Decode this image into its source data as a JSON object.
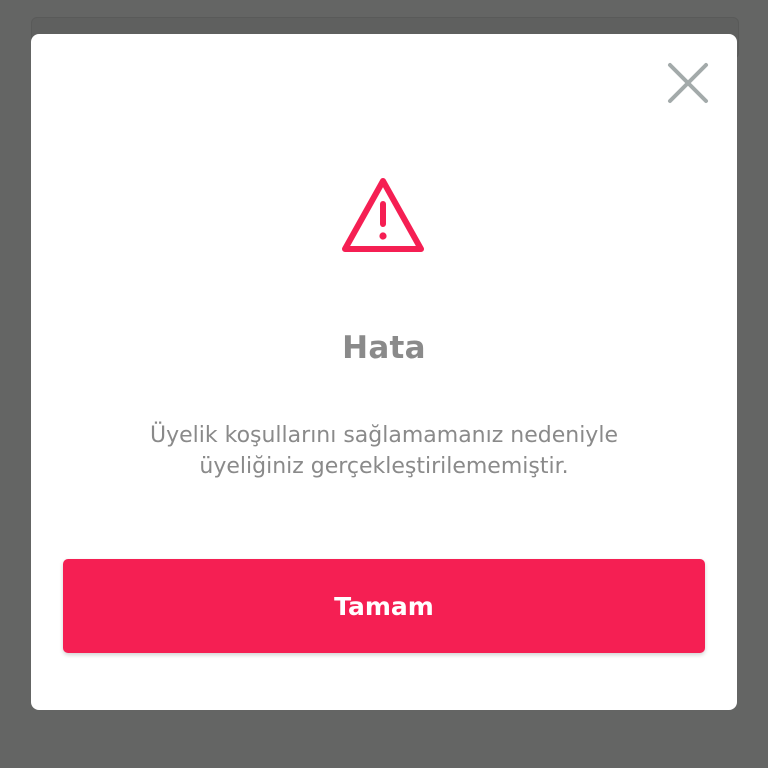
{
  "dialog": {
    "title": "Hata",
    "message_line1": "Üyelik koşullarını sağlamamanız nedeniyle",
    "message_line2": "üyeliğiniz gerçekleştirilememiştir.",
    "ok_label": "Tamam",
    "icons": {
      "close": "close-icon",
      "warning": "warning-triangle-icon"
    }
  },
  "colors": {
    "accent": "#f51f53",
    "text": "#8a8a8a",
    "close_icon": "#a3aaaa",
    "backdrop": "#646564"
  }
}
